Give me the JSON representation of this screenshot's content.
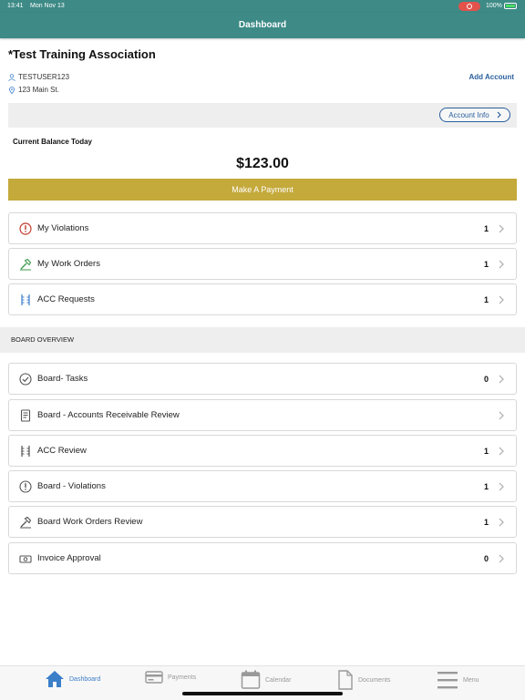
{
  "status_bar": {
    "time": "13:41",
    "date": "Mon Nov 13",
    "battery": "100%"
  },
  "nav": {
    "title": "Dashboard"
  },
  "association": {
    "name": "*Test Training Association",
    "user": "TESTUSER123",
    "address": "123 Main St.",
    "add_account_label": "Add Account",
    "account_info_label": "Account Info"
  },
  "balance": {
    "label": "Current Balance Today",
    "value": "$123.00",
    "pay_label": "Make A Payment",
    "pay_color": "#c4a93b"
  },
  "my_items": [
    {
      "label": "My Violations",
      "count": "1",
      "icon": "alert-circle-icon"
    },
    {
      "label": "My Work Orders",
      "count": "1",
      "icon": "hammer-icon"
    },
    {
      "label": "ACC Requests",
      "count": "1",
      "icon": "architecture-icon"
    }
  ],
  "board": {
    "heading": "BOARD OVERVIEW",
    "items": [
      {
        "label": "Board- Tasks",
        "count": "0",
        "icon": "check-circle-icon"
      },
      {
        "label": "Board - Accounts Receivable Review",
        "count": "",
        "icon": "ledger-icon"
      },
      {
        "label": "ACC Review",
        "count": "1",
        "icon": "architecture-icon"
      },
      {
        "label": "Board - Violations",
        "count": "1",
        "icon": "alert-circle-icon"
      },
      {
        "label": "Board Work Orders Review",
        "count": "1",
        "icon": "hammer-icon"
      },
      {
        "label": "Invoice Approval",
        "count": "0",
        "icon": "money-icon"
      }
    ]
  },
  "tabs": [
    {
      "label": "Dashboard",
      "icon": "home-icon",
      "active": true
    },
    {
      "label": "Payments",
      "icon": "credit-card-icon",
      "active": false
    },
    {
      "label": "Calendar",
      "icon": "calendar-icon",
      "active": false
    },
    {
      "label": "Documents",
      "icon": "document-icon",
      "active": false
    },
    {
      "label": "Menu",
      "icon": "menu-icon",
      "active": false
    }
  ],
  "colors": {
    "header": "#3d8a86",
    "accent": "#2a5f9e",
    "tab_active": "#3b7fc9",
    "violation_red": "#c0392b",
    "work_order_green": "#3a9a4a"
  }
}
